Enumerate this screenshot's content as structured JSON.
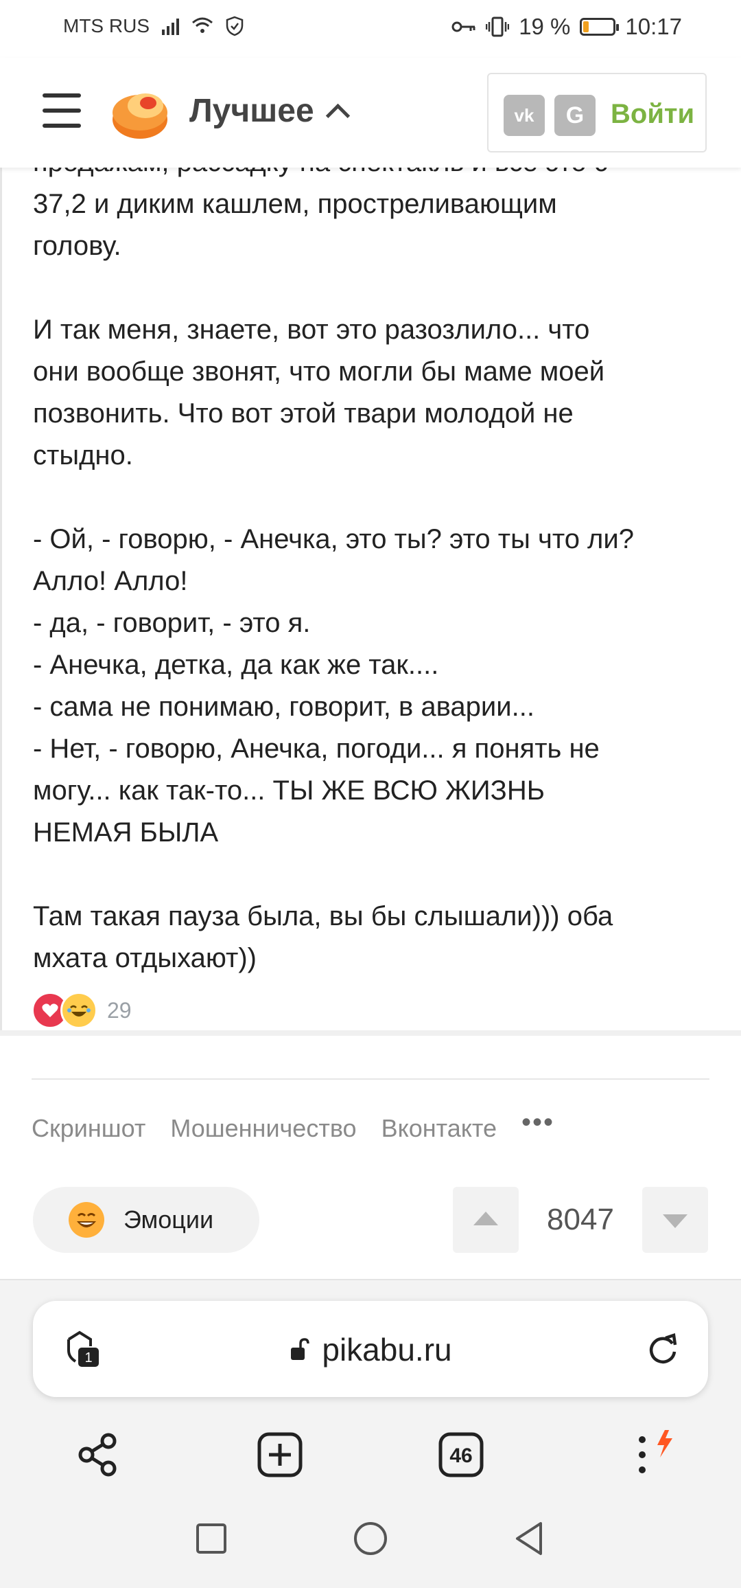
{
  "status_bar": {
    "carrier": "MTS RUS",
    "battery_percent": "19 %",
    "battery_level": 0.19,
    "time": "10:17"
  },
  "header": {
    "section_title": "Лучшее",
    "vk_label": "vk",
    "google_label": "G",
    "login_label": "Войти",
    "accent": "#7cb342"
  },
  "post": {
    "lines": [
      "продажам, рассадку на спектакль и всё это с",
      "37,2 и диким кашлем, простреливающим",
      "голову.",
      "",
      "И так меня, знаете, вот это разозлило... что",
      "они вообще звонят, что могли бы маме моей",
      "позвонить. Что вот этой твари молодой не",
      "стыдно.",
      "",
      "- Ой, - говорю, - Анечка, это ты? это ты что ли?",
      "Алло! Алло!",
      "- да, - говорит, - это я.",
      "- Анечка, детка, да как же так....",
      "- сама не понимаю, говорит, в аварии...",
      "- Нет, - говорю, Анечка, погоди... я понять не",
      "могу... как так-то... ТЫ ЖЕ ВСЮ ЖИЗНЬ",
      "НЕМАЯ БЫЛА",
      "",
      "Там такая пауза была, вы бы слышали))) оба",
      "мхата отдыхают))"
    ],
    "reaction_count": "29"
  },
  "tags": [
    "Скриншот",
    "Мошенничество",
    "Вконтакте"
  ],
  "tags_more": "•••",
  "actions": {
    "emotions_label": "Эмоции",
    "rating": "8047"
  },
  "browser": {
    "url": "pikabu.ru",
    "tab_shield_badge": "1",
    "tabs_count": "46"
  }
}
